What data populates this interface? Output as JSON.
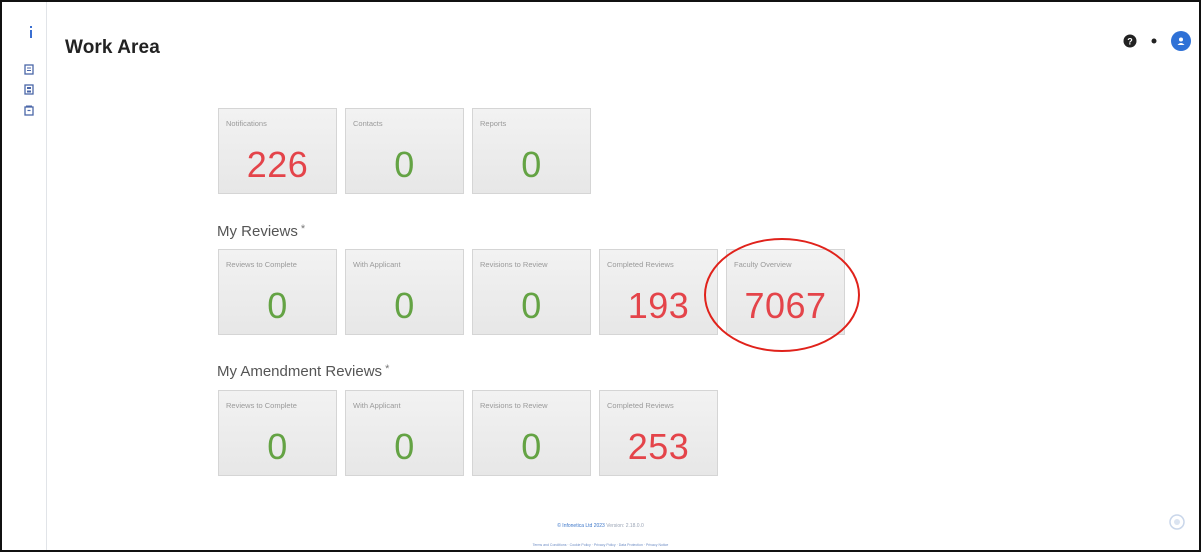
{
  "header": {
    "title": "Work Area"
  },
  "summary_tiles": [
    {
      "label": "Notifications",
      "value": "226",
      "tone": "red"
    },
    {
      "label": "Contacts",
      "value": "0",
      "tone": "green"
    },
    {
      "label": "Reports",
      "value": "0",
      "tone": "green"
    }
  ],
  "my_reviews": {
    "title": "My Reviews",
    "marker": "*",
    "tiles": [
      {
        "label": "Reviews to Complete",
        "value": "0",
        "tone": "green"
      },
      {
        "label": "With Applicant",
        "value": "0",
        "tone": "green"
      },
      {
        "label": "Revisions to Review",
        "value": "0",
        "tone": "green"
      },
      {
        "label": "Completed Reviews",
        "value": "193",
        "tone": "red"
      },
      {
        "label": "Faculty Overview",
        "value": "7067",
        "tone": "red"
      }
    ]
  },
  "my_amendment_reviews": {
    "title": "My Amendment Reviews",
    "marker": "*",
    "tiles": [
      {
        "label": "Reviews to Complete",
        "value": "0",
        "tone": "green"
      },
      {
        "label": "With Applicant",
        "value": "0",
        "tone": "green"
      },
      {
        "label": "Revisions to Review",
        "value": "0",
        "tone": "green"
      },
      {
        "label": "Completed Reviews",
        "value": "253",
        "tone": "red"
      }
    ]
  },
  "footer": {
    "copyright": "© Infonetica Ltd 2023",
    "version": "Version: 2.18.0.0",
    "links": "Terms and Conditions · Cookie Policy · Privacy Policy · Data Protection · Privacy Notice"
  },
  "colors": {
    "value_red": "#e4444a",
    "value_green": "#64a344",
    "accent_blue": "#2f71d6",
    "highlight": "#e0221b"
  },
  "icons": {
    "sidebar": [
      "info-icon",
      "document-icon",
      "folder-icon",
      "archive-icon"
    ],
    "header": [
      "help-icon",
      "menu-dot-icon",
      "user-avatar"
    ],
    "footer": [
      "chat-help-icon"
    ]
  }
}
